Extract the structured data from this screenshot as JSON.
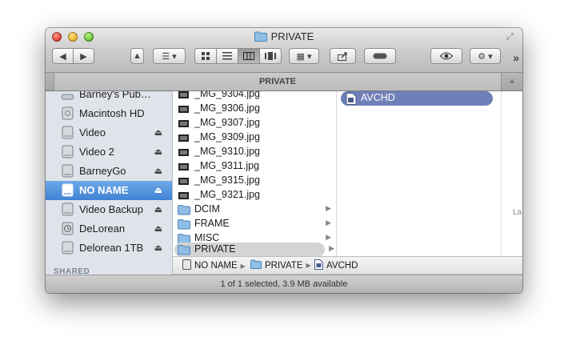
{
  "window": {
    "title": "PRIVATE",
    "tab_title": "PRIVATE"
  },
  "toolbar": {
    "icons": [
      "back-icon",
      "forward-icon",
      "eject-icon",
      "arrange-icon",
      "icon-view-icon",
      "list-view-icon",
      "column-view-icon",
      "coverflow-view-icon",
      "grid-menu-icon",
      "share-icon",
      "tag-icon",
      "quicklook-eye-icon",
      "gear-icon",
      "chevron-more-icon"
    ]
  },
  "sidebar": {
    "items": [
      {
        "label": "Barney's Pub…",
        "eject": false,
        "icon": "network-drive-icon"
      },
      {
        "label": "Macintosh HD",
        "eject": false,
        "icon": "hard-drive-icon"
      },
      {
        "label": "Video",
        "eject": true,
        "icon": "drive-icon"
      },
      {
        "label": "Video 2",
        "eject": true,
        "icon": "drive-icon"
      },
      {
        "label": "BarneyGo",
        "eject": true,
        "icon": "drive-icon"
      },
      {
        "label": "NO NAME",
        "eject": true,
        "icon": "drive-icon",
        "selected": true
      },
      {
        "label": "Video Backup",
        "eject": true,
        "icon": "drive-icon"
      },
      {
        "label": "DeLorean",
        "eject": true,
        "icon": "timemachine-icon"
      },
      {
        "label": "Delorean 1TB",
        "eject": true,
        "icon": "drive-icon"
      }
    ],
    "shared_header": "SHARED"
  },
  "column1": {
    "files": [
      "_MG_9304.jpg",
      "_MG_9306.jpg",
      "_MG_9307.jpg",
      "_MG_9309.jpg",
      "_MG_9310.jpg",
      "_MG_9311.jpg",
      "_MG_9315.jpg",
      "_MG_9321.jpg"
    ],
    "folders": [
      "DCIM",
      "FRAME",
      "MISC",
      "PRIVATE"
    ],
    "selected_folder": "PRIVATE"
  },
  "column2": {
    "items": [
      "AVCHD"
    ]
  },
  "column3": {
    "partial_text": "La"
  },
  "pathbar": {
    "crumbs": [
      "NO NAME",
      "PRIVATE",
      "AVCHD"
    ]
  },
  "status": {
    "text": "1 of 1 selected, 3.9 MB available"
  },
  "colors": {
    "sidebar_selection": "#3f82d4",
    "column_selection": "#6f7fb8",
    "inactive_selection": "#d4d4d4"
  }
}
